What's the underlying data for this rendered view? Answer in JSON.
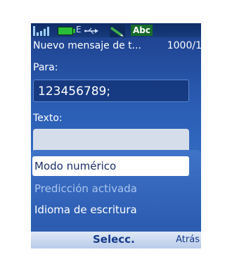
{
  "status": {
    "network_type": "E",
    "input_mode_label": "Abc",
    "colors": {
      "battery": "#2bbd3a",
      "input_mode_bg": "#186b2a"
    }
  },
  "header": {
    "title": "Nuevo mensaje de t...",
    "counter": "1000/1"
  },
  "form": {
    "to_label": "Para:",
    "to_value": "123456789;",
    "text_label": "Texto:"
  },
  "menu": {
    "items": [
      {
        "label": "Modo numérico",
        "selected": true
      },
      {
        "label": "Predicción activada",
        "selected": false
      },
      {
        "label": "Idioma de escritura",
        "selected": false
      }
    ]
  },
  "softkeys": {
    "middle": "Selecc.",
    "right": "Atrás"
  }
}
